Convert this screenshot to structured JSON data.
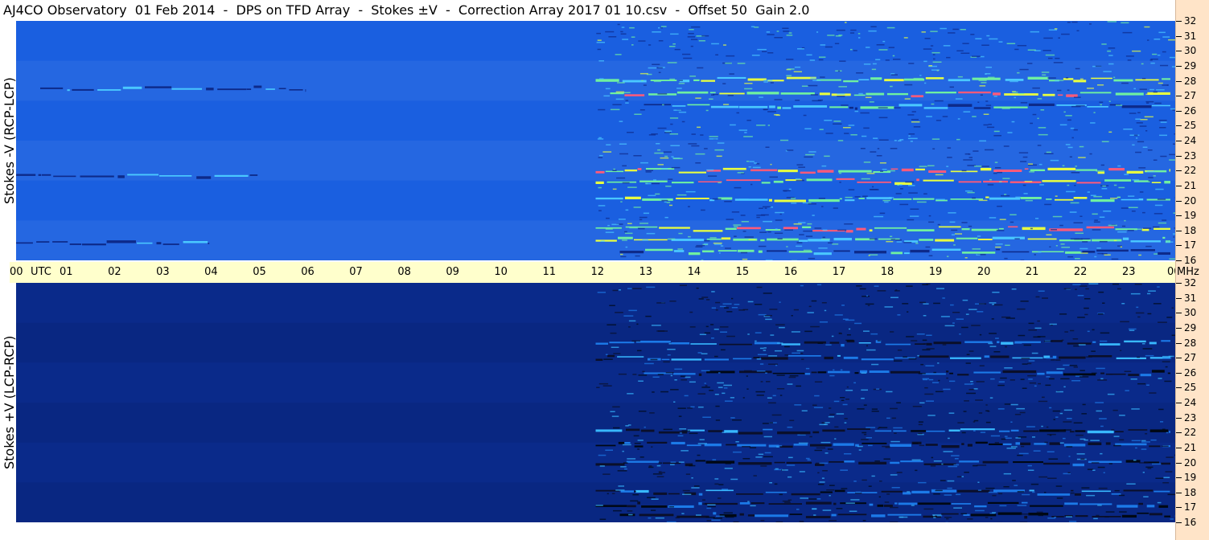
{
  "title": "AJ4CO Observatory  01 Feb 2014  -  DPS on TFD Array  -  Stokes ±V  -  Correction Array 2017 01 10.csv  -  Offset 50  Gain 2.0",
  "panels": {
    "top_label": "Stokes -V (RCP-LCP)",
    "bottom_label": "Stokes +V (LCP-RCP)"
  },
  "time_axis": {
    "utc_label": "UTC",
    "ticks": [
      "00",
      "01",
      "02",
      "03",
      "04",
      "05",
      "06",
      "07",
      "08",
      "09",
      "10",
      "11",
      "12",
      "13",
      "14",
      "15",
      "16",
      "17",
      "18",
      "19",
      "20",
      "21",
      "22",
      "23",
      "00"
    ]
  },
  "freq_axis": {
    "unit_label": "MHz",
    "ticks": [
      "32",
      "31",
      "30",
      "29",
      "28",
      "27",
      "26",
      "25",
      "24",
      "23",
      "22",
      "21",
      "20",
      "19",
      "18",
      "17",
      "16"
    ]
  },
  "colors": {
    "top_background": "#1a5fe0",
    "bottom_background": "#0a2a8a",
    "axis_fill": "#ffffcc",
    "freq_axis_fill": "#ffe4c8"
  },
  "chart_data": {
    "type": "heatmap",
    "title": "AJ4CO Observatory  01 Feb 2014  -  DPS on TFD Array  -  Stokes ±V  -  Correction Array 2017 01 10.csv  -  Offset 50  Gain 2.0",
    "xlabel": "UTC",
    "ylabel": "MHz",
    "xlim": [
      0,
      24
    ],
    "ylim": [
      16,
      32
    ],
    "panels": [
      {
        "name": "Stokes -V (RCP-LCP)",
        "activity_bands": [
          {
            "freq": 28.1,
            "start": 12.0,
            "end": 23.9,
            "level": 0.75
          },
          {
            "freq": 27.1,
            "start": 12.3,
            "end": 23.9,
            "level": 0.85
          },
          {
            "freq": 26.3,
            "start": 13.0,
            "end": 23.9,
            "level": 0.55
          },
          {
            "freq": 22.0,
            "start": 12.0,
            "end": 23.9,
            "level": 0.95
          },
          {
            "freq": 21.3,
            "start": 12.0,
            "end": 23.9,
            "level": 0.9
          },
          {
            "freq": 20.1,
            "start": 12.0,
            "end": 23.9,
            "level": 0.7
          },
          {
            "freq": 18.1,
            "start": 12.0,
            "end": 23.9,
            "level": 0.95
          },
          {
            "freq": 17.4,
            "start": 12.0,
            "end": 23.9,
            "level": 0.7
          },
          {
            "freq": 16.6,
            "start": 12.5,
            "end": 23.9,
            "level": 0.6
          },
          {
            "freq": 27.5,
            "start": 0.5,
            "end": 6.0,
            "level": 0.4
          },
          {
            "freq": 21.7,
            "start": 0.0,
            "end": 5.0,
            "level": 0.35
          },
          {
            "freq": 17.2,
            "start": 0.0,
            "end": 4.0,
            "level": 0.35
          }
        ]
      },
      {
        "name": "Stokes +V (LCP-RCP)",
        "activity_bands": [
          {
            "freq": 28.0,
            "start": 12.0,
            "end": 23.9,
            "level": 0.6
          },
          {
            "freq": 27.0,
            "start": 12.0,
            "end": 23.9,
            "level": 0.55
          },
          {
            "freq": 26.0,
            "start": 13.0,
            "end": 23.9,
            "level": 0.4
          },
          {
            "freq": 22.1,
            "start": 12.0,
            "end": 23.9,
            "level": 0.5
          },
          {
            "freq": 21.2,
            "start": 12.0,
            "end": 23.9,
            "level": 0.45
          },
          {
            "freq": 20.0,
            "start": 12.0,
            "end": 23.9,
            "level": 0.4
          },
          {
            "freq": 18.0,
            "start": 12.0,
            "end": 23.9,
            "level": 0.5
          },
          {
            "freq": 17.2,
            "start": 12.0,
            "end": 23.9,
            "level": 0.45
          },
          {
            "freq": 16.5,
            "start": 12.5,
            "end": 23.9,
            "level": 0.4
          }
        ]
      }
    ]
  }
}
